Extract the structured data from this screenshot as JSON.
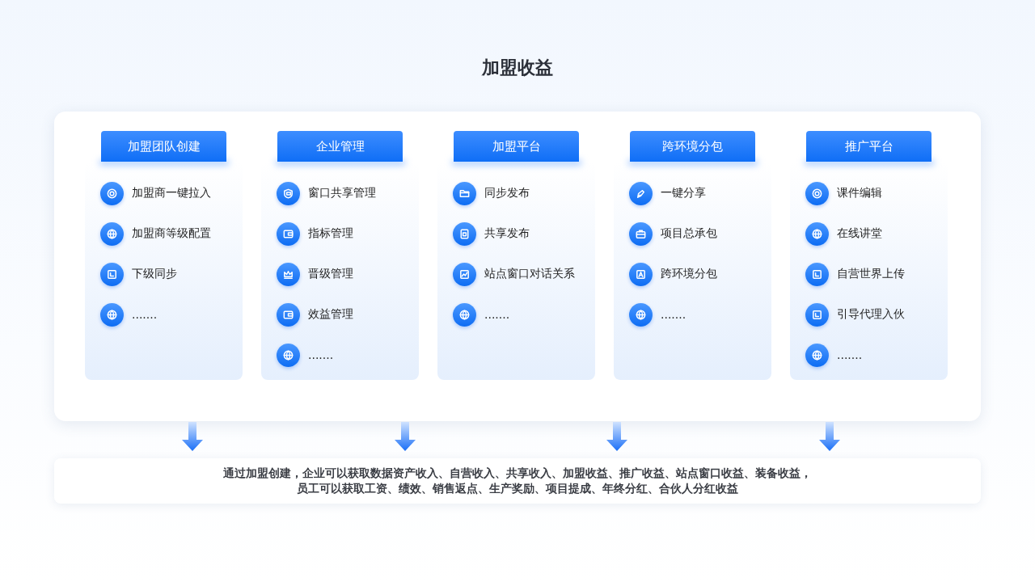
{
  "title": "加盟收益",
  "columns": [
    {
      "heading": "加盟团队创建",
      "items": [
        "加盟商一键拉入",
        "加盟商等级配置",
        "下级同步",
        "......."
      ]
    },
    {
      "heading": "企业管理",
      "items": [
        "窗口共享管理",
        "指标管理",
        "晋级管理",
        "效益管理",
        "......."
      ]
    },
    {
      "heading": "加盟平台",
      "items": [
        "同步发布",
        "共享发布",
        "站点窗口对话关系",
        "......."
      ]
    },
    {
      "heading": "跨环境分包",
      "items": [
        "一键分享",
        "项目总承包",
        "跨环境分包",
        "......."
      ]
    },
    {
      "heading": "推广平台",
      "items": [
        "课件编辑",
        "在线讲堂",
        "自营世界上传",
        "引导代理入伙",
        "......."
      ]
    }
  ],
  "summary": [
    "通过加盟创建，企业可以获取数据资产收入、自营收入、共享收入、加盟收益、推广收益、站点窗口收益、装备收益，",
    "员工可以获取工资、绩效、销售返点、生产奖励、项目提成、年终分红、合伙人分红收益"
  ]
}
